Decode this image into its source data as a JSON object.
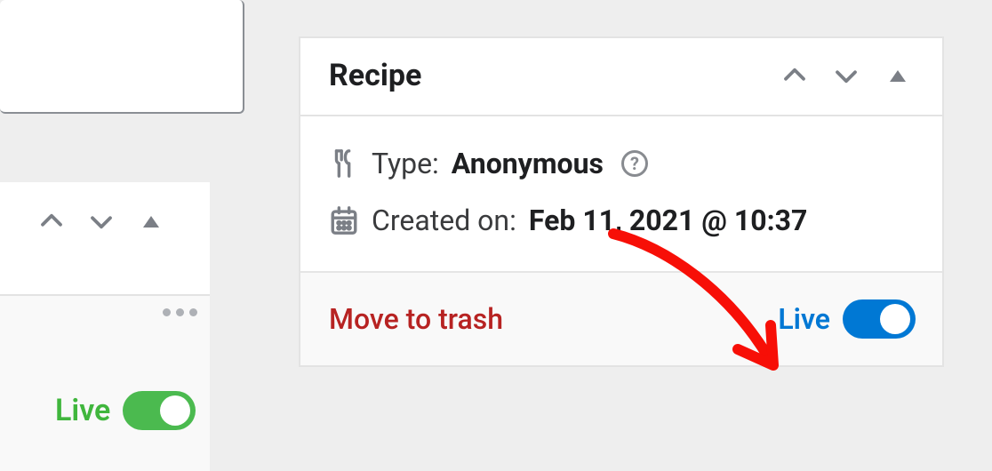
{
  "panel": {
    "title": "Recipe",
    "type_label": "Type:",
    "type_value": "Anonymous",
    "created_label": "Created on:",
    "created_value": "Feb 11, 2021 @ 10:37",
    "trash_label": "Move to trash",
    "live_label": "Live"
  },
  "left": {
    "live_label": "Live"
  }
}
